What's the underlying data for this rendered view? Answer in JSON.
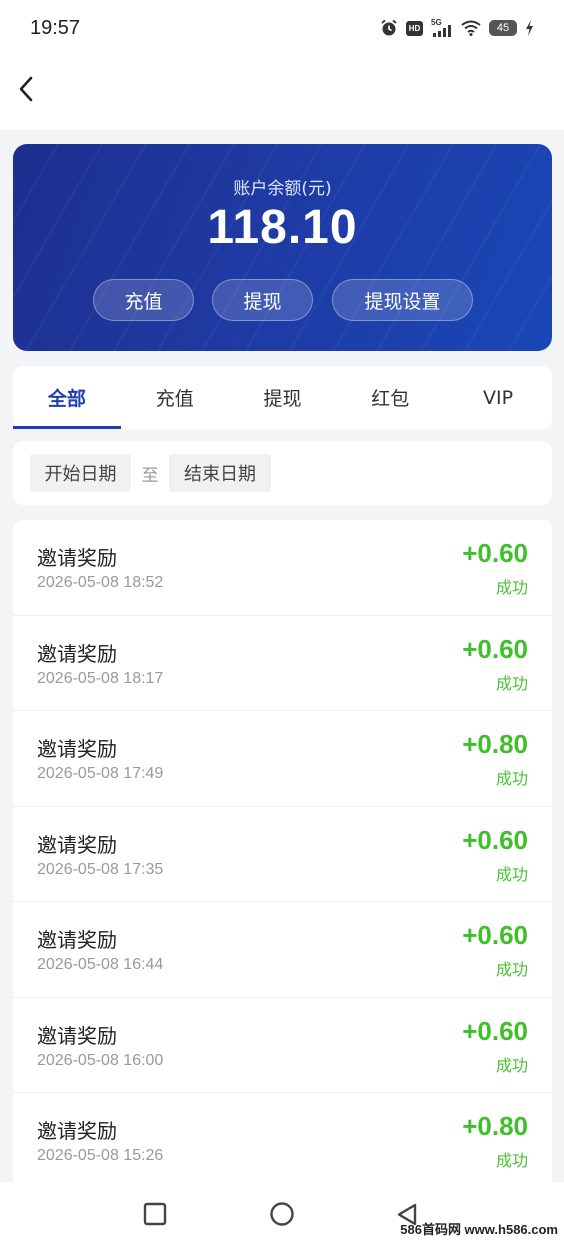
{
  "status_bar": {
    "time": "19:57",
    "icons": [
      "alarm-icon",
      "hd-icon",
      "signal-5g-icon",
      "wifi-icon",
      "battery-icon",
      "charging-icon"
    ],
    "hd_label": "HD",
    "network_label": "5G",
    "battery_level": "45"
  },
  "nav": {
    "back_icon": "chevron-left-icon"
  },
  "balance_card": {
    "label": "账户余额(元)",
    "amount": "118.10",
    "buttons": {
      "recharge": "充值",
      "withdraw": "提现",
      "withdraw_settings": "提现设置"
    },
    "colors": {
      "gradient_start": "#1d2f8f",
      "gradient_end": "#1947b6"
    }
  },
  "tabs": [
    {
      "label": "全部",
      "active": true
    },
    {
      "label": "充值",
      "active": false
    },
    {
      "label": "提现",
      "active": false
    },
    {
      "label": "红包",
      "active": false
    },
    {
      "label": "VIP",
      "active": false
    }
  ],
  "filter": {
    "start_placeholder": "开始日期",
    "separator": "至",
    "end_placeholder": "结束日期"
  },
  "records": [
    {
      "title": "邀请奖励",
      "time": "2026-05-08 18:52",
      "amount": "+0.60",
      "status": "成功"
    },
    {
      "title": "邀请奖励",
      "time": "2026-05-08 18:17",
      "amount": "+0.60",
      "status": "成功"
    },
    {
      "title": "邀请奖励",
      "time": "2026-05-08 17:49",
      "amount": "+0.80",
      "status": "成功"
    },
    {
      "title": "邀请奖励",
      "time": "2026-05-08 17:35",
      "amount": "+0.60",
      "status": "成功"
    },
    {
      "title": "邀请奖励",
      "time": "2026-05-08 16:44",
      "amount": "+0.60",
      "status": "成功"
    },
    {
      "title": "邀请奖励",
      "time": "2026-05-08 16:00",
      "amount": "+0.60",
      "status": "成功"
    },
    {
      "title": "邀请奖励",
      "time": "2026-05-08 15:26",
      "amount": "+0.80",
      "status": "成功"
    }
  ],
  "colors": {
    "accent": "#1f3fb0",
    "positive": "#3fbf2a"
  },
  "system_nav": {
    "icons": [
      "square-recents-icon",
      "circle-home-icon",
      "triangle-back-icon"
    ]
  },
  "watermark": "586首码网 www.h586.com"
}
